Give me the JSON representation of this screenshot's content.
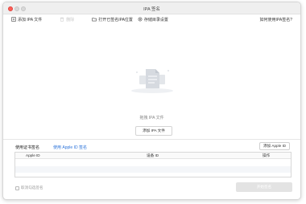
{
  "window": {
    "title": "IPA 签名"
  },
  "toolbar": {
    "add_ipa_label": "添加 IPA 文件",
    "disabled_label": "删除",
    "open_location_label": "打开已签名IPA位置",
    "save_dir_label": "存储目录设置",
    "help_label": "如何使用IPA签名?"
  },
  "dropzone": {
    "hint_text": "拖拽 IPA 文件",
    "add_button_label": "添加 IPA 文件"
  },
  "signing": {
    "label": "使用证书签名",
    "link_text": "使用 Apple ID 签名",
    "add_apple_id_label": "添加 Apple ID"
  },
  "table": {
    "columns": [
      "Apple ID",
      "设备 ID",
      "操作"
    ],
    "rows": []
  },
  "footer": {
    "checkbox_label": "取消勾选签名",
    "start_button_label": "开始签名",
    "checkbox_checked": false
  },
  "colors": {
    "accent_link": "#2d74da",
    "close_button": "#fd5f57",
    "disabled_button": "#e3e3e3"
  },
  "icons": {
    "add": "plus-square-icon",
    "delete": "trash-icon",
    "folder": "folder-icon",
    "settings": "gear-icon",
    "document": "document-icon"
  }
}
